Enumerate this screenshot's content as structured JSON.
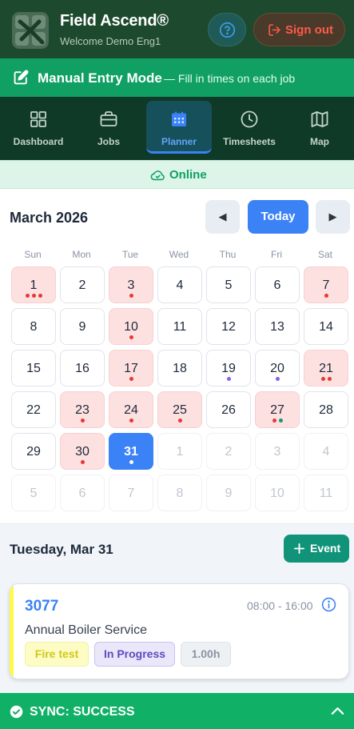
{
  "header": {
    "title": "Field Ascend®",
    "subtitle": "Welcome Demo Eng1",
    "signout_label": "Sign out",
    "help_icon": "question-circle-icon",
    "signout_icon": "logout-icon"
  },
  "mode_banner": {
    "title": "Manual Entry Mode",
    "subtitle": "— Fill in times on each job",
    "icon": "edit-square-icon"
  },
  "nav": {
    "items": [
      {
        "label": "Dashboard",
        "icon": "grid-icon",
        "active": false
      },
      {
        "label": "Jobs",
        "icon": "briefcase-icon",
        "active": false
      },
      {
        "label": "Planner",
        "icon": "calendar-icon",
        "active": true
      },
      {
        "label": "Timesheets",
        "icon": "clock-icon",
        "active": false
      },
      {
        "label": "Map",
        "icon": "map-icon",
        "active": false
      }
    ]
  },
  "status": {
    "label": "Online",
    "icon": "cloud-check-icon"
  },
  "calendar": {
    "month_label": "March 2026",
    "prev_label": "◀",
    "today_label": "Today",
    "next_label": "▶",
    "weekdays": [
      "Sun",
      "Mon",
      "Tue",
      "Wed",
      "Thu",
      "Fri",
      "Sat"
    ],
    "days": [
      {
        "n": "1",
        "red": true,
        "dots": [
          "#e53935",
          "#e53935",
          "#e53935"
        ]
      },
      {
        "n": "2"
      },
      {
        "n": "3",
        "red": true,
        "dots": [
          "#e53935"
        ]
      },
      {
        "n": "4"
      },
      {
        "n": "5"
      },
      {
        "n": "6"
      },
      {
        "n": "7",
        "red": true,
        "dots": [
          "#e53935"
        ]
      },
      {
        "n": "8"
      },
      {
        "n": "9"
      },
      {
        "n": "10",
        "red": true,
        "dots": [
          "#e53935"
        ]
      },
      {
        "n": "11"
      },
      {
        "n": "12"
      },
      {
        "n": "13"
      },
      {
        "n": "14"
      },
      {
        "n": "15"
      },
      {
        "n": "16"
      },
      {
        "n": "17",
        "red": true,
        "dots": [
          "#e53935"
        ]
      },
      {
        "n": "18"
      },
      {
        "n": "19",
        "dots": [
          "#8b5cf6"
        ]
      },
      {
        "n": "20",
        "dots": [
          "#8b5cf6"
        ]
      },
      {
        "n": "21",
        "red": true,
        "dots": [
          "#e53935",
          "#e53935"
        ]
      },
      {
        "n": "22"
      },
      {
        "n": "23",
        "red": true,
        "dots": [
          "#e53935"
        ]
      },
      {
        "n": "24",
        "red": true,
        "dots": [
          "#e53935"
        ]
      },
      {
        "n": "25",
        "red": true,
        "dots": [
          "#e53935"
        ]
      },
      {
        "n": "26"
      },
      {
        "n": "27",
        "red": true,
        "dots": [
          "#e53935",
          "#0f9b74"
        ]
      },
      {
        "n": "28"
      },
      {
        "n": "29"
      },
      {
        "n": "30",
        "red": true,
        "dots": [
          "#e53935"
        ]
      },
      {
        "n": "31",
        "selected": true,
        "dots": [
          "#ffffff"
        ]
      },
      {
        "n": "1",
        "out": true
      },
      {
        "n": "2",
        "out": true
      },
      {
        "n": "3",
        "out": true
      },
      {
        "n": "4",
        "out": true
      },
      {
        "n": "5",
        "out": true
      },
      {
        "n": "6",
        "out": true
      },
      {
        "n": "7",
        "out": true
      },
      {
        "n": "8",
        "out": true
      },
      {
        "n": "9",
        "out": true
      },
      {
        "n": "10",
        "out": true
      },
      {
        "n": "11",
        "out": true
      }
    ]
  },
  "day_view": {
    "date_label": "Tuesday, Mar 31",
    "event_button": "Event"
  },
  "job": {
    "id": "3077",
    "time": "08:00 - 16:00",
    "title": "Annual Boiler Service",
    "tags": {
      "fire": "Fire test",
      "status": "In Progress",
      "hours": "1.00h"
    },
    "accent": "#fef94a"
  },
  "sync": {
    "label": "SYNC: SUCCESS"
  },
  "colors": {
    "brand_dark": "#1d4a2e",
    "accent_green": "#10a064",
    "primary_blue": "#3b82f6",
    "event_red": "#e53935"
  }
}
